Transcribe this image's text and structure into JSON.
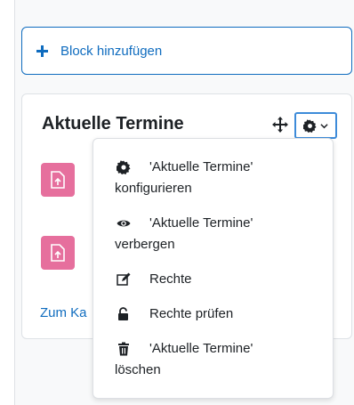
{
  "add_block": {
    "label": "Block hinzufügen",
    "icon": "plus-icon"
  },
  "block": {
    "title": "Aktuelle Termine",
    "link_partial": "Zum Ka"
  },
  "menu": {
    "items": [
      {
        "icon": "gear-icon",
        "line1": "'Aktuelle Termine'",
        "line2": "konfigurieren"
      },
      {
        "icon": "eye-icon",
        "line1": "'Aktuelle Termine'",
        "line2": "verbergen"
      },
      {
        "icon": "edit-icon",
        "line1": "Rechte",
        "line2": ""
      },
      {
        "icon": "unlock-icon",
        "line1": "Rechte prüfen",
        "line2": ""
      },
      {
        "icon": "trash-icon",
        "line1": "'Aktuelle Termine'",
        "line2": "löschen"
      }
    ]
  },
  "colors": {
    "link": "#0f6cbf",
    "event_icon": "#e66f9d",
    "focus": "#3d8bd9"
  }
}
